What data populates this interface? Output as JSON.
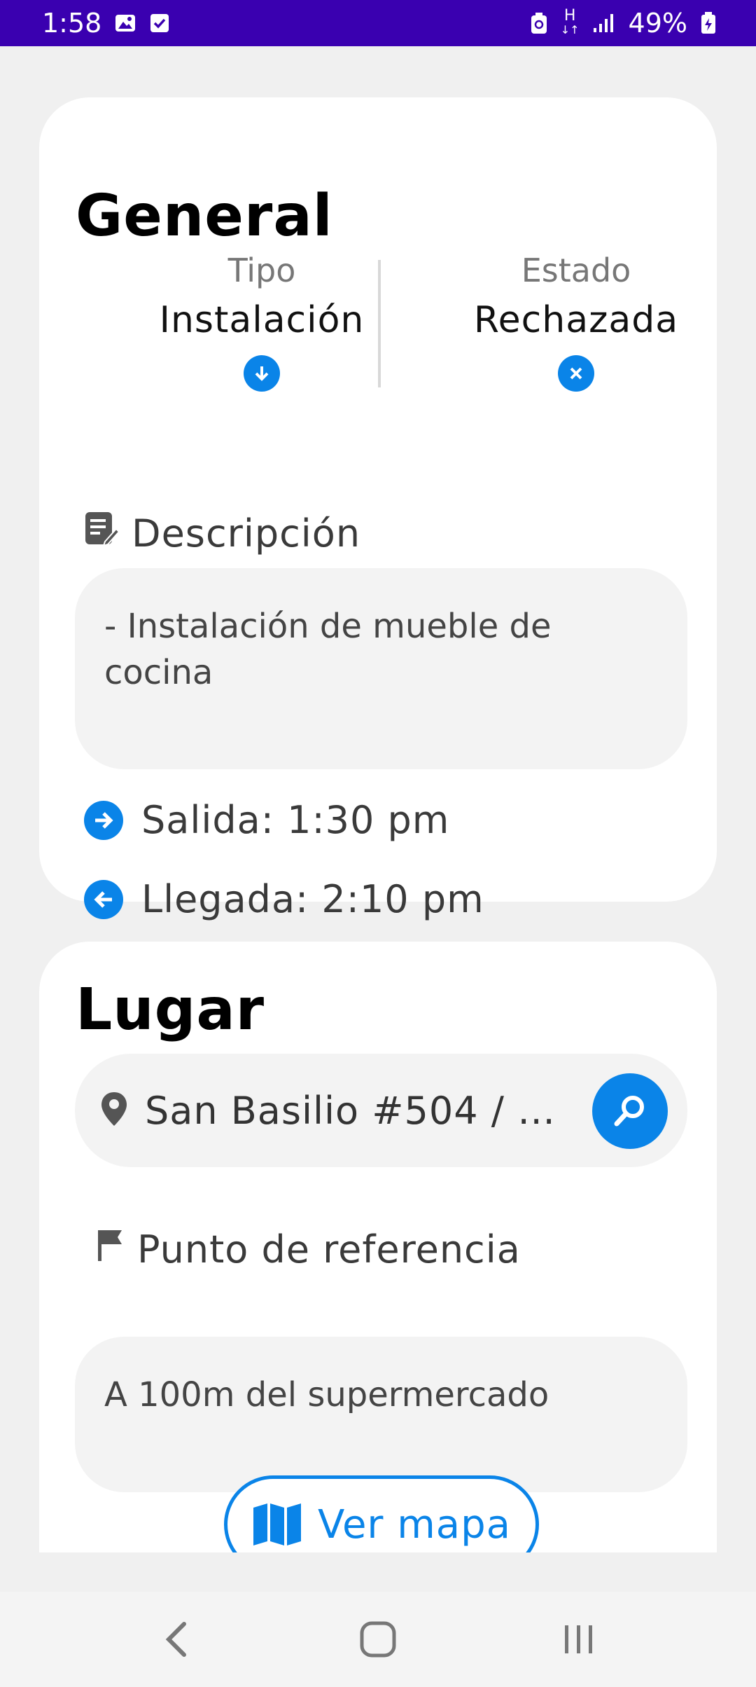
{
  "status_bar": {
    "time": "1:58",
    "battery": "49%",
    "network": "H"
  },
  "general": {
    "title": "General",
    "tipo_label": "Tipo",
    "tipo_value": "Instalación",
    "estado_label": "Estado",
    "estado_value": "Rechazada",
    "descripcion_label": "Descripción",
    "descripcion_text": "- Instalación de mueble de cocina",
    "salida_text": "Salida: 1:30 pm",
    "llegada_text": "Llegada: 2:10 pm"
  },
  "lugar": {
    "title": "Lugar",
    "address": "San Basilio #504 / Re…",
    "referencia_label": "Punto de referencia",
    "referencia_text": "A 100m del supermercado",
    "ver_mapa_label": "Ver mapa"
  },
  "colors": {
    "accent": "#0a84e8",
    "status_bar": "#3a00b0",
    "background": "#f0f0f0",
    "card": "#ffffff"
  },
  "icons": {
    "tipo": "arrow-down-circle-icon",
    "estado": "x-circle-icon",
    "descripcion": "edit-note-icon",
    "salida": "arrow-right-circle-icon",
    "llegada": "arrow-left-circle-icon",
    "address": "location-pin-icon",
    "search": "search-icon",
    "referencia": "flag-icon",
    "map": "map-icon"
  }
}
